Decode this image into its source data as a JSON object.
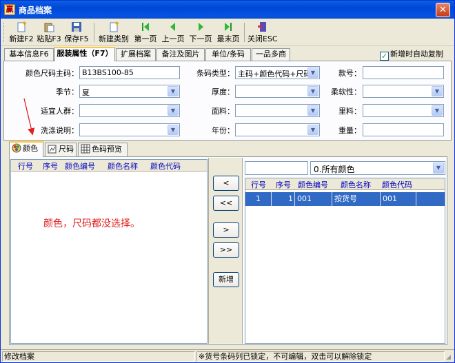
{
  "window": {
    "title": "商品档案"
  },
  "toolbar": {
    "new": "新建F2",
    "paste": "粘贴F3",
    "save": "保存F5",
    "new_category": "新建类别",
    "first": "第一页",
    "prev": "上一页",
    "next": "下一页",
    "last": "最末页",
    "close": "关闭ESC"
  },
  "tabs": [
    "基本信息F6",
    "服装属性（F7）",
    "扩展档案",
    "备注及图片",
    "单位/条码",
    "一品多商"
  ],
  "autocopy": {
    "label": "新增时自动复制",
    "checked": true
  },
  "form": {
    "color_size_code_label": "颜色尺码主码：",
    "color_size_code_value": "B13BS100-85",
    "season_label": "季节：",
    "season_value": "夏",
    "target_label": "适宜人群：",
    "target_value": "",
    "wash_label": "洗涤说明：",
    "wash_value": "",
    "barcode_type_label": "条码类型：",
    "barcode_type_value": "主码+颜色代码+尺码",
    "thickness_label": "厚度：",
    "thickness_value": "",
    "fabric_label": "面料：",
    "fabric_value": "",
    "year_label": "年份：",
    "year_value": "",
    "style_no_label": "款号：",
    "style_no_value": "",
    "softness_label": "柔软性：",
    "softness_value": "",
    "lining_label": "里料：",
    "lining_value": "",
    "weight_label": "重量：",
    "weight_value": ""
  },
  "subtabs": [
    "颜色",
    "尺码",
    "色码预览"
  ],
  "left_grid": {
    "headers": [
      "行号",
      "序号",
      "颜色编号",
      "颜色名称",
      "颜色代码"
    ]
  },
  "filter": {
    "search_value": "",
    "select_value": "0.所有颜色"
  },
  "right_grid": {
    "headers": [
      "行号",
      "序号",
      "颜色编号",
      "颜色名称",
      "颜色代码"
    ],
    "rows": [
      [
        "1",
        "1",
        "001",
        "按货号",
        "001"
      ]
    ]
  },
  "transfer_buttons": {
    "add_one": "<",
    "add_all": "<<",
    "remove_one": ">",
    "remove_all": ">>",
    "new": "新增"
  },
  "annotation": "颜色，尺码都没选择。",
  "status": {
    "left": "修改档案",
    "middle": "",
    "right": "※货号条码列已锁定，不可编辑，双击可以解除锁定"
  },
  "colors": {
    "selection": "#316AC5",
    "annotation": "#E02020",
    "header_text": "#0000C0"
  }
}
